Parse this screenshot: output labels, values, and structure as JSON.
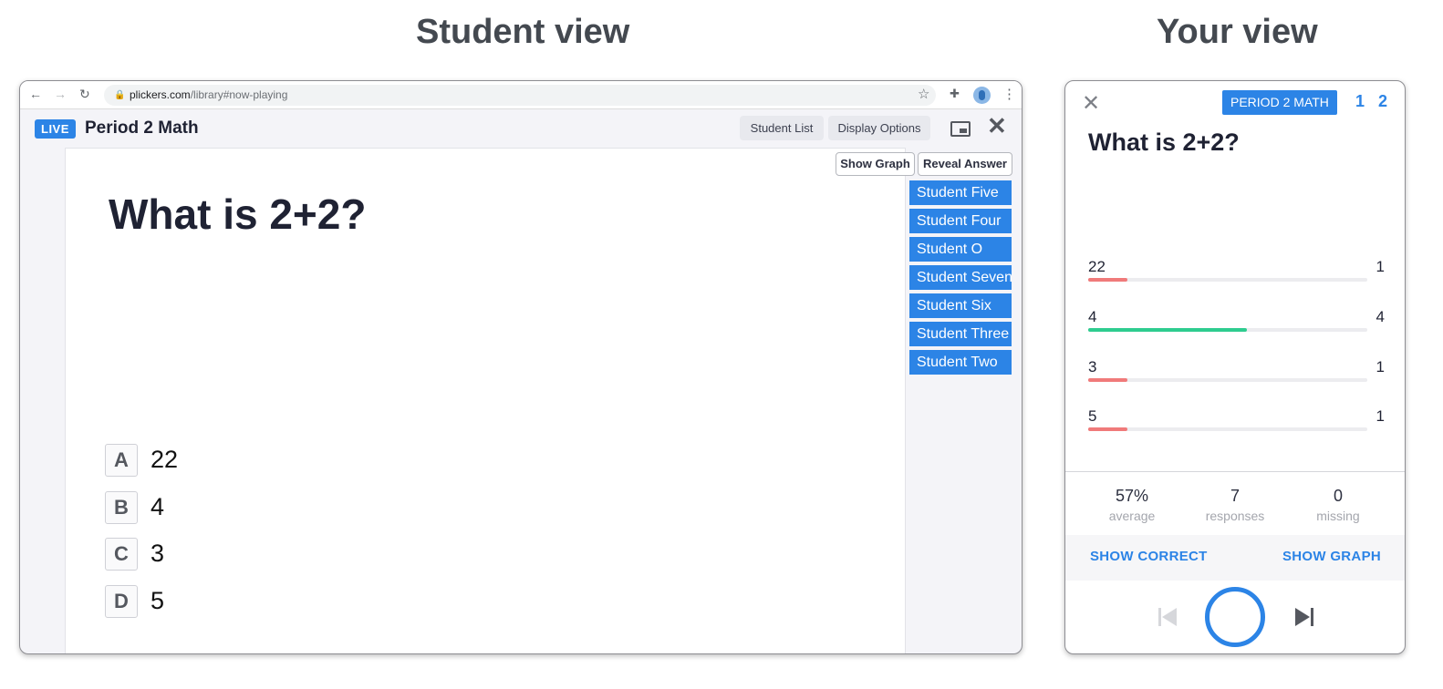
{
  "headings": {
    "student_view": "Student view",
    "your_view": "Your view"
  },
  "browser": {
    "url_host": "plickers.com",
    "url_path": "/library#now-playing",
    "icons": {
      "back": "back-arrow-icon",
      "forward": "forward-arrow-icon",
      "reload": "reload-icon",
      "lock": "lock-icon",
      "star": "star-icon",
      "extensions": "puzzle-icon",
      "profile": "profile-avatar",
      "menu": "kebab-menu-icon"
    }
  },
  "student_app": {
    "live_badge": "LIVE",
    "class_name": "Period 2 Math",
    "toolbar": {
      "student_list": "Student List",
      "display_options": "Display Options"
    },
    "question": "What is 2+2?",
    "choices": [
      {
        "letter": "A",
        "text": "22"
      },
      {
        "letter": "B",
        "text": "4"
      },
      {
        "letter": "C",
        "text": "3"
      },
      {
        "letter": "D",
        "text": "5"
      }
    ],
    "side_buttons": {
      "show_graph": "Show Graph",
      "reveal_answer": "Reveal Answer"
    },
    "students": [
      "Student Five",
      "Student Four",
      "Student O",
      "Student Seven",
      "Student Six",
      "Student Three",
      "Student Two"
    ],
    "accent_color": "#2c84e6"
  },
  "teacher_app": {
    "class_badge": "PERIOD 2 MATH",
    "question_counter": "1 2",
    "question": "What is 2+2?",
    "results": [
      {
        "label": "22",
        "count": "1",
        "fraction": 0.14,
        "color": "#f07a7a"
      },
      {
        "label": "4",
        "count": "4",
        "fraction": 0.57,
        "color": "#2ecc8f"
      },
      {
        "label": "3",
        "count": "1",
        "fraction": 0.14,
        "color": "#f07a7a"
      },
      {
        "label": "5",
        "count": "1",
        "fraction": 0.14,
        "color": "#f07a7a"
      }
    ],
    "stats": {
      "average_value": "57%",
      "average_label": "average",
      "responses_value": "7",
      "responses_label": "responses",
      "missing_value": "0",
      "missing_label": "missing"
    },
    "actions": {
      "show_correct": "SHOW CORRECT",
      "show_graph": "SHOW GRAPH"
    }
  }
}
